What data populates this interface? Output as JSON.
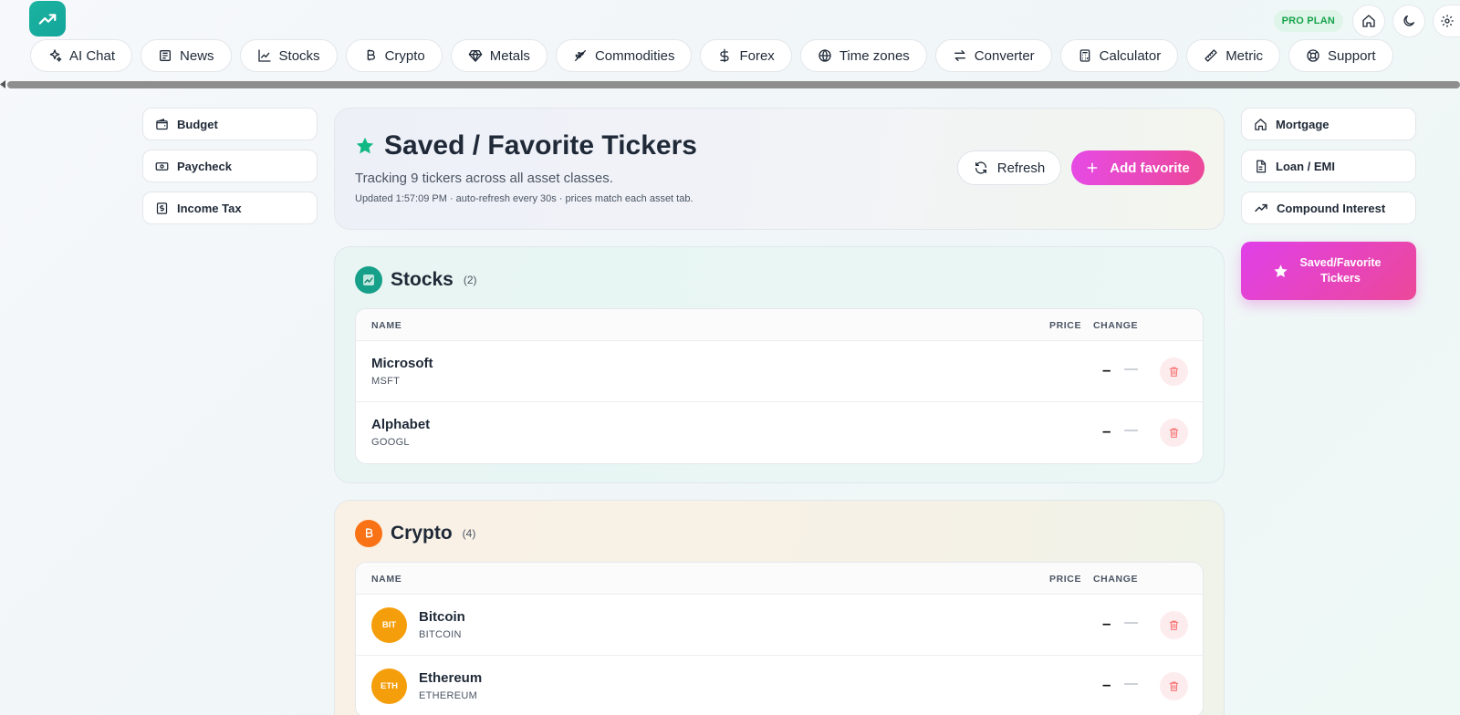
{
  "header": {
    "plan_badge": "PRO PLAN",
    "brand_color": "#14b8a6",
    "accent_color": "#e64ae4"
  },
  "nav": {
    "items": [
      {
        "label": "AI Chat",
        "icon": "sparkles-icon"
      },
      {
        "label": "News",
        "icon": "newspaper-icon"
      },
      {
        "label": "Stocks",
        "icon": "chart-line-icon"
      },
      {
        "label": "Crypto",
        "icon": "bitcoin-icon"
      },
      {
        "label": "Metals",
        "icon": "diamond-icon"
      },
      {
        "label": "Commodities",
        "icon": "wheat-icon"
      },
      {
        "label": "Forex",
        "icon": "dollar-icon"
      },
      {
        "label": "Time zones",
        "icon": "globe-icon"
      },
      {
        "label": "Converter",
        "icon": "swap-arrows-icon"
      },
      {
        "label": "Calculator",
        "icon": "calculator-icon"
      },
      {
        "label": "Metric",
        "icon": "ruler-icon"
      },
      {
        "label": "Support",
        "icon": "lifebuoy-icon"
      }
    ]
  },
  "left_tools": [
    {
      "label": "Budget",
      "icon": "wallet-icon"
    },
    {
      "label": "Paycheck",
      "icon": "banknote-icon"
    },
    {
      "label": "Income Tax",
      "icon": "receipt-icon"
    }
  ],
  "right_tools": [
    {
      "label": "Mortgage",
      "icon": "home-icon"
    },
    {
      "label": "Loan / EMI",
      "icon": "document-icon"
    },
    {
      "label": "Compound Interest",
      "icon": "trending-up-icon"
    },
    {
      "label": "Saved/Favorite Tickers",
      "icon": "star-icon",
      "active": true
    }
  ],
  "hero": {
    "title": "Saved / Favorite Tickers",
    "subtitle": "Tracking 9 tickers across all asset classes.",
    "updated": "Updated 1:57:09 PM · auto-refresh every 30s · prices match each asset tab.",
    "refresh_label": "Refresh",
    "add_label": "Add favorite"
  },
  "sections": {
    "stocks": {
      "title": "Stocks",
      "count": "(2)",
      "columns": {
        "name": "NAME",
        "price": "PRICE",
        "change": "CHANGE"
      },
      "rows": [
        {
          "name": "Microsoft",
          "symbol": "MSFT",
          "price": "–",
          "change": "—"
        },
        {
          "name": "Alphabet",
          "symbol": "GOOGL",
          "price": "–",
          "change": "—"
        }
      ]
    },
    "crypto": {
      "title": "Crypto",
      "count": "(4)",
      "columns": {
        "name": "NAME",
        "price": "PRICE",
        "change": "CHANGE"
      },
      "rows": [
        {
          "badge": "BIT",
          "name": "Bitcoin",
          "symbol": "BITCOIN",
          "price": "–",
          "change": "—"
        },
        {
          "badge": "ETH",
          "name": "Ethereum",
          "symbol": "ETHEREUM",
          "price": "–",
          "change": "—"
        }
      ]
    }
  }
}
